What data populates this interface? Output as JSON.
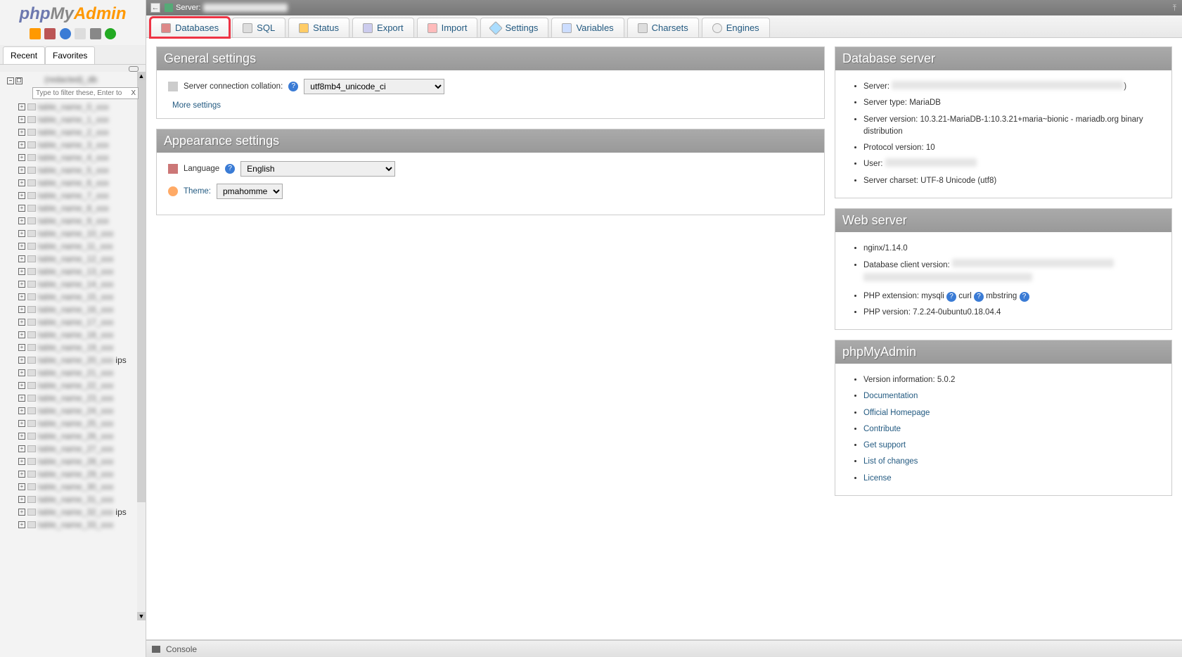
{
  "logo": {
    "php": "php",
    "my": "My",
    "admin": "Admin"
  },
  "nav": {
    "recent_label": "Recent",
    "favorites_label": "Favorites",
    "filter_placeholder": "Type to filter these, Enter to",
    "db_root": "(redacted)_db",
    "table_suffix_5": "ips",
    "table_suffix_32": "ips"
  },
  "breadcrumb": {
    "server_label": "Server: "
  },
  "tabs": {
    "databases": "Databases",
    "sql": "SQL",
    "status": "Status",
    "export": "Export",
    "import": "Import",
    "settings": "Settings",
    "variables": "Variables",
    "charsets": "Charsets",
    "engines": "Engines"
  },
  "general": {
    "title": "General settings",
    "collation_label": "Server connection collation:",
    "collation_value": "utf8mb4_unicode_ci",
    "more_settings": "More settings"
  },
  "appearance": {
    "title": "Appearance settings",
    "language_label": "Language",
    "language_value": "English",
    "theme_label": "Theme:",
    "theme_value": "pmahomme"
  },
  "dbserver": {
    "title": "Database server",
    "server_label": "Server: ",
    "server_value": "(redacted server host string)",
    "type_label": "Server type: ",
    "type_value": "MariaDB",
    "version_label": "Server version: ",
    "version_value": "10.3.21-MariaDB-1:10.3.21+maria~bionic - mariadb.org binary distribution",
    "protocol_label": "Protocol version: ",
    "protocol_value": "10",
    "user_label": "User: ",
    "user_value": "(redacted)",
    "charset_label": "Server charset: ",
    "charset_value": "UTF-8 Unicode (utf8)"
  },
  "webserver": {
    "title": "Web server",
    "nginx": "nginx/1.14.0",
    "client_label": "Database client version: ",
    "client_value": "(redacted client version string spanning two lines of text)",
    "ext_label": "PHP extension: ",
    "ext_mysqli": "mysqli",
    "ext_curl": "curl",
    "ext_mbstring": "mbstring",
    "phpver_label": "PHP version: ",
    "phpver_value": "7.2.24-0ubuntu0.18.04.4"
  },
  "pma": {
    "title": "phpMyAdmin",
    "ver_label": "Version information: ",
    "ver_value": "5.0.2",
    "documentation": "Documentation",
    "homepage": "Official Homepage",
    "contribute": "Contribute",
    "support": "Get support",
    "changes": "List of changes",
    "license": "License"
  },
  "console": {
    "label": "Console"
  }
}
